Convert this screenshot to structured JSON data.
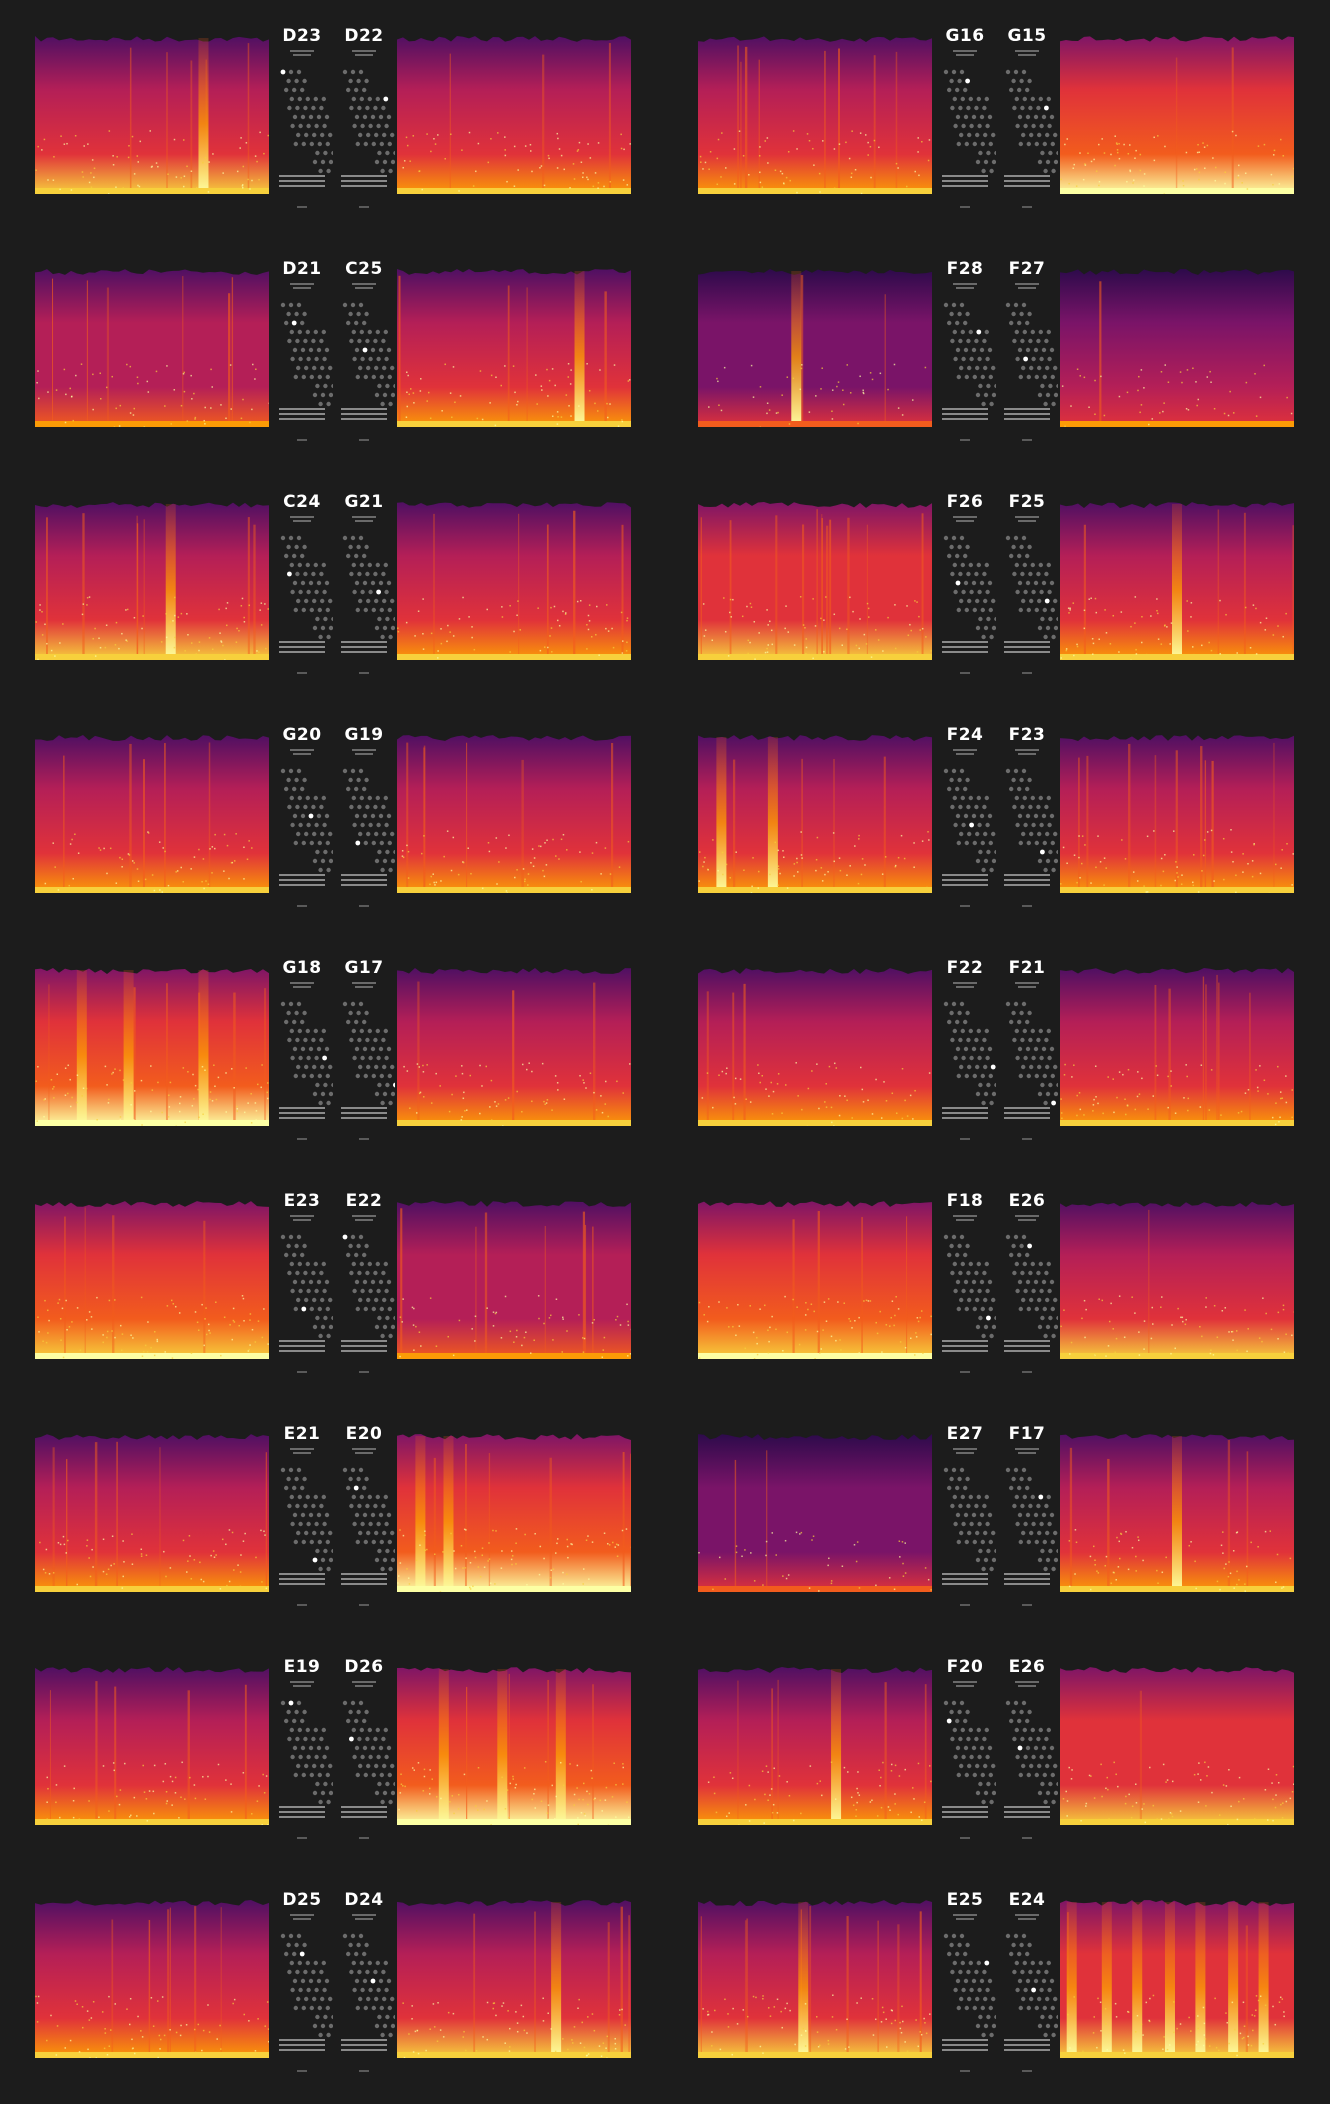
{
  "layout_rows": [
    {
      "left": {
        "codes": [
          "D23",
          "D22"
        ],
        "spectrograms": [
          {
            "hot": 0.7,
            "bands": [
              0.72
            ],
            "streaks": 5
          },
          {
            "hot": 0.55,
            "bands": [],
            "streaks": 3
          }
        ]
      },
      "right": {
        "codes": [
          "G16",
          "G15"
        ],
        "spectrograms": [
          {
            "hot": 0.55,
            "bands": [],
            "streaks": 8
          },
          {
            "hot": 0.95,
            "bands": [],
            "streaks": 2
          }
        ]
      }
    },
    {
      "left": {
        "codes": [
          "D21",
          "C25"
        ],
        "spectrograms": [
          {
            "hot": 0.45,
            "bands": [],
            "streaks": 6
          },
          {
            "hot": 0.55,
            "bands": [
              0.78
            ],
            "streaks": 4
          }
        ]
      },
      "right": {
        "codes": [
          "F28",
          "F27"
        ],
        "spectrograms": [
          {
            "hot": 0.15,
            "bands": [
              0.42
            ],
            "streaks": 2
          },
          {
            "hot": 0.18,
            "bands": [],
            "streaks": 1
          }
        ]
      }
    },
    {
      "left": {
        "codes": [
          "C24",
          "G21"
        ],
        "spectrograms": [
          {
            "hot": 0.7,
            "bands": [
              0.58
            ],
            "streaks": 7
          },
          {
            "hot": 0.55,
            "bands": [],
            "streaks": 5
          }
        ]
      },
      "right": {
        "codes": [
          "F26",
          "F25"
        ],
        "spectrograms": [
          {
            "hot": 0.75,
            "bands": [],
            "streaks": 12
          },
          {
            "hot": 0.6,
            "bands": [
              0.5
            ],
            "streaks": 4
          }
        ]
      }
    },
    {
      "left": {
        "codes": [
          "G20",
          "G19"
        ],
        "spectrograms": [
          {
            "hot": 0.5,
            "bands": [],
            "streaks": 5
          },
          {
            "hot": 0.55,
            "bands": [],
            "streaks": 6
          }
        ]
      },
      "right": {
        "codes": [
          "F24",
          "F23"
        ],
        "spectrograms": [
          {
            "hot": 0.6,
            "bands": [
              0.32,
              0.1
            ],
            "streaks": 4
          },
          {
            "hot": 0.65,
            "bands": [],
            "streaks": 9
          }
        ]
      }
    },
    {
      "left": {
        "codes": [
          "G18",
          "G17"
        ],
        "spectrograms": [
          {
            "hot": 0.95,
            "bands": [
              0.2,
              0.4,
              0.72
            ],
            "streaks": 6
          },
          {
            "hot": 0.6,
            "bands": [],
            "streaks": 3
          }
        ]
      },
      "right": {
        "codes": [
          "F22",
          "F21"
        ],
        "spectrograms": [
          {
            "hot": 0.55,
            "bands": [],
            "streaks": 3
          },
          {
            "hot": 0.65,
            "bands": [],
            "streaks": 7
          }
        ]
      }
    },
    {
      "left": {
        "codes": [
          "E23",
          "E22"
        ],
        "spectrograms": [
          {
            "hot": 0.85,
            "bands": [],
            "streaks": 4
          },
          {
            "hot": 0.4,
            "bands": [],
            "streaks": 7
          }
        ]
      },
      "right": {
        "codes": [
          "F18",
          "E26"
        ],
        "spectrograms": [
          {
            "hot": 0.85,
            "bands": [],
            "streaks": 4
          },
          {
            "hot": 0.7,
            "bands": [],
            "streaks": 1
          }
        ]
      }
    },
    {
      "left": {
        "codes": [
          "E21",
          "E20"
        ],
        "spectrograms": [
          {
            "hot": 0.6,
            "bands": [],
            "streaks": 6
          },
          {
            "hot": 0.95,
            "bands": [
              0.1,
              0.22
            ],
            "streaks": 6
          }
        ]
      },
      "right": {
        "codes": [
          "E27",
          "F17"
        ],
        "spectrograms": [
          {
            "hot": 0.12,
            "bands": [],
            "streaks": 2
          },
          {
            "hot": 0.6,
            "bands": [
              0.5
            ],
            "streaks": 4
          }
        ]
      }
    },
    {
      "left": {
        "codes": [
          "E19",
          "D26"
        ],
        "spectrograms": [
          {
            "hot": 0.5,
            "bands": [],
            "streaks": 5
          },
          {
            "hot": 0.9,
            "bands": [
              0.2,
              0.45,
              0.7
            ],
            "streaks": 4
          }
        ]
      },
      "right": {
        "codes": [
          "F20",
          "E26"
        ],
        "spectrograms": [
          {
            "hot": 0.6,
            "bands": [
              0.59
            ],
            "streaks": 5
          },
          {
            "hot": 0.75,
            "bands": [],
            "streaks": 1
          }
        ]
      }
    },
    {
      "left": {
        "codes": [
          "D25",
          "D24"
        ],
        "spectrograms": [
          {
            "hot": 0.6,
            "bands": [],
            "streaks": 6
          },
          {
            "hot": 0.7,
            "bands": [
              0.68
            ],
            "streaks": 5
          }
        ]
      },
      "right": {
        "codes": [
          "E25",
          "E24"
        ],
        "spectrograms": [
          {
            "hot": 0.7,
            "bands": [
              0.45
            ],
            "streaks": 9
          },
          {
            "hot": 0.75,
            "bands": [
              0.05,
              0.2,
              0.33,
              0.47,
              0.6,
              0.74,
              0.87
            ],
            "streaks": 2
          }
        ]
      }
    }
  ],
  "colors": {
    "background": "#1c1c1c",
    "label": "#ffffff",
    "map_dots": "#6c6c6c",
    "map_highlight": "#ffffff",
    "colormap": [
      "#0d0221",
      "#2a0a4a",
      "#4b0f63",
      "#7a1468",
      "#b41f57",
      "#e0323a",
      "#f25c1d",
      "#fb9b06",
      "#f7d03c",
      "#fcffa4"
    ]
  }
}
